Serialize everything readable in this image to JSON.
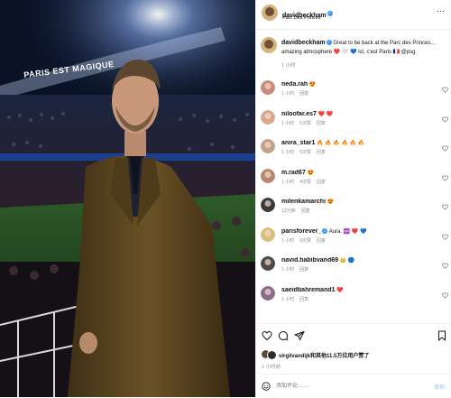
{
  "photo": {
    "stadium_sign": "PARIS EST MAGIQUE"
  },
  "post": {
    "username": "davidbeckham",
    "location": "Parc Des Princes",
    "more_label": "···"
  },
  "caption": {
    "username": "davidbeckham",
    "text_line1": "Great to be back at the Parc des Princes...",
    "text_line2": "amazing atmosphere ❤️ 🤍 💙 Ici, c'est Paris 🇫🇷 @psg",
    "time": "1 小时"
  },
  "comments": [
    {
      "username": "neda.rah",
      "text": "😍",
      "time": "1 小时",
      "likes": "",
      "reply": "回复",
      "verified": false
    },
    {
      "username": "niloofar.es7",
      "text": "❤️ ❤️",
      "time": "1 小时",
      "likes": "5次赞",
      "reply": "回复",
      "verified": false
    },
    {
      "username": "anira_star1",
      "text": "🔥 🔥 🔥 🔥 🔥 🔥",
      "time": "1 小时",
      "likes": "5次赞",
      "reply": "回复",
      "verified": false
    },
    {
      "username": "m.rad67",
      "text": "😍",
      "time": "1 小时",
      "likes": "4次赞",
      "reply": "回复",
      "verified": false
    },
    {
      "username": "milenkamarchi",
      "text": "😍",
      "time": "12分钟",
      "likes": "",
      "reply": "回复",
      "verified": false
    },
    {
      "username": "parisforever_",
      "text": "Aura. ♾️ ❤️ 💙",
      "time": "1 小时",
      "likes": "9次赞",
      "reply": "回复",
      "verified": true
    },
    {
      "username": "navid.habibvand69",
      "text": "👑 🔵",
      "time": "1 小时",
      "likes": "",
      "reply": "回复",
      "verified": false
    },
    {
      "username": "saeidbahremand1",
      "text": "❤️",
      "time": "1 小时",
      "likes": "",
      "reply": "回复",
      "verified": false
    }
  ],
  "actions": {
    "liked_by": "virgilvandijk和其他11.5万位用户赞了",
    "time": "1 小时前"
  },
  "add_comment": {
    "placeholder": "添加评论……",
    "post_label": "发布"
  },
  "colors": {
    "accent": "#3897f0",
    "heart": "#ed4956",
    "coat": "#5a4520"
  },
  "icons": [
    "heart-icon",
    "comment-icon",
    "share-icon",
    "bookmark-icon",
    "emoji-icon",
    "more-icon",
    "verified-icon"
  ]
}
